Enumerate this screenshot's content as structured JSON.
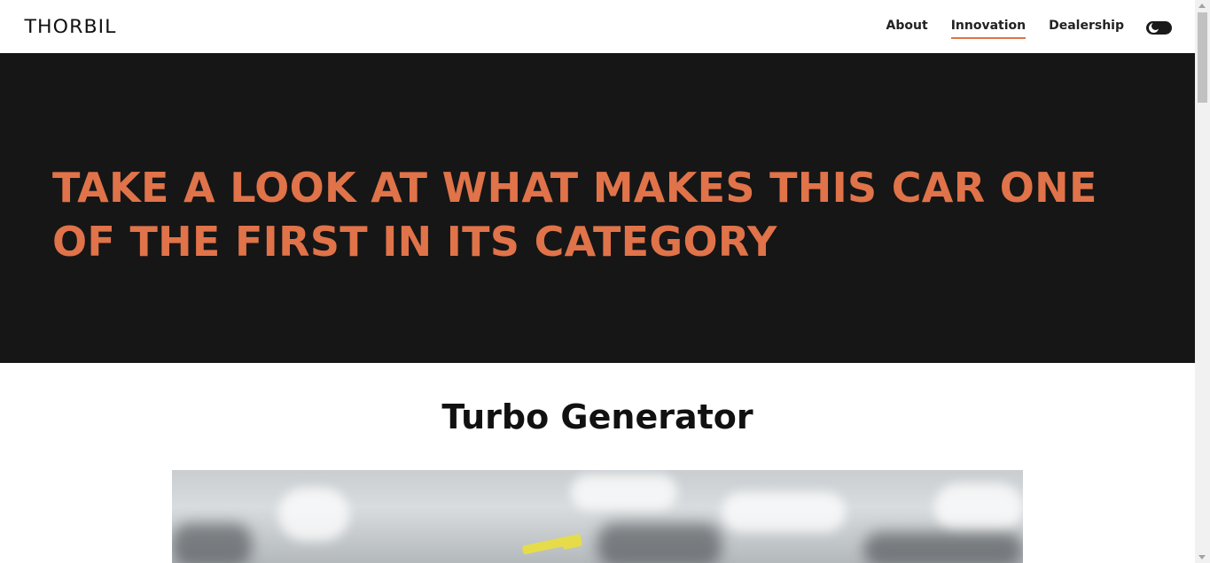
{
  "header": {
    "logo": "THORBIL",
    "nav": [
      {
        "label": "About",
        "active": false
      },
      {
        "label": "Innovation",
        "active": true
      },
      {
        "label": "Dealership",
        "active": false
      }
    ],
    "theme_toggle_icon": "moon-icon"
  },
  "hero": {
    "title": "TAKE A LOOK AT WHAT MAKES THIS CAR ONE OF THE FIRST IN ITS CATEGORY"
  },
  "section": {
    "title": "Turbo Generator",
    "image_icon": "turbo-generator-image"
  },
  "colors": {
    "accent": "#e07349",
    "hero_background": "#161616",
    "text": "#111111"
  }
}
